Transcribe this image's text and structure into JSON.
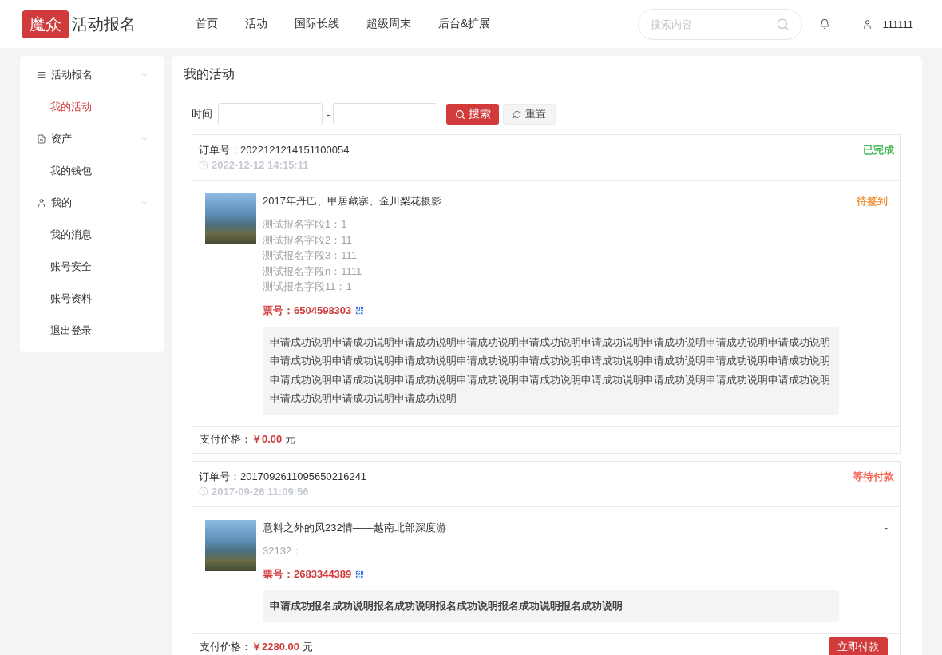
{
  "header": {
    "logo_mark": "魔众",
    "site_title": "活动报名",
    "nav": [
      {
        "label": "首页",
        "selected": false
      },
      {
        "label": "活动",
        "selected": false
      },
      {
        "label": "国际长线",
        "selected": false
      },
      {
        "label": "超级周末",
        "selected": false
      },
      {
        "label": "后台&扩展",
        "selected": false
      }
    ],
    "search": {
      "placeholder": "搜索内容"
    },
    "user": {
      "name": "111111"
    }
  },
  "sidebar": {
    "groups": [
      {
        "label": "活动报名",
        "expanded": true,
        "children": [
          {
            "label": "我的活动",
            "selected": true
          }
        ]
      },
      {
        "label": "资产",
        "expanded": true,
        "children": [
          {
            "label": "我的钱包",
            "selected": false
          }
        ]
      },
      {
        "label": "我的",
        "expanded": true,
        "children": [
          {
            "label": "我的消息",
            "selected": false
          },
          {
            "label": "账号安全",
            "selected": false
          },
          {
            "label": "账号资料",
            "selected": false
          },
          {
            "label": "退出登录",
            "selected": false
          }
        ]
      }
    ]
  },
  "content": {
    "title": "我的活动",
    "filter": {
      "label": "时间",
      "separator": "-",
      "search_button": "搜索",
      "reset_button": "重置"
    },
    "orders": [
      {
        "order_no": "订单号：2022121214151100054",
        "time": "2022-12-12 14:15:11",
        "status": {
          "text": "已完成",
          "color": "#2fb344"
        },
        "items": [
          {
            "title": "2017年丹巴、甲居藏寨、金川梨花摄影",
            "status": {
              "text": "待签到",
              "color": "#f0861e"
            },
            "fields": [
              "测试报名字段1：1",
              "测试报名字段2：11",
              "测试报名字段3：111",
              "测试报名字段n：1111",
              "测试报名字段11：1"
            ],
            "ticket": "票号：6504598303",
            "note": {
              "text": "申请成功说明申请成功说明申请成功说明申请成功说明申请成功说明申请成功说明申请成功说明申请成功说明申请成功说明申请成功说明申请成功说明申请成功说明申请成功说明申请成功说明申请成功说明申请成功说明申请成功说明申请成功说明申请成功说明申请成功说明申请成功说明申请成功说明申请成功说明申请成功说明申请成功说明申请成功说明申请成功说明申请成功说明申请成功说明申请成功说明",
              "emphasized": false
            }
          }
        ],
        "payment": {
          "label": "支付价格：",
          "amount": "￥0.00",
          "unit": "元"
        }
      },
      {
        "order_no": "订单号：2017092611095650216241",
        "time": "2017-09-26 11:09:56",
        "status": {
          "text": "等待付款",
          "color": "#f5503f"
        },
        "items": [
          {
            "title": "意料之外的风232情——越南北部深度游",
            "status": {
              "text": "-"
            },
            "fields": [
              "32132："
            ],
            "ticket": "票号：2683344389",
            "note": {
              "text": "申请成功报名成功说明报名成功说明报名成功说明报名成功说明报名成功说明",
              "emphasized": true
            }
          }
        ],
        "payment": {
          "label": "支付价格：",
          "amount": "￥2280.00",
          "unit": "元",
          "action": "立即付款"
        }
      }
    ]
  }
}
